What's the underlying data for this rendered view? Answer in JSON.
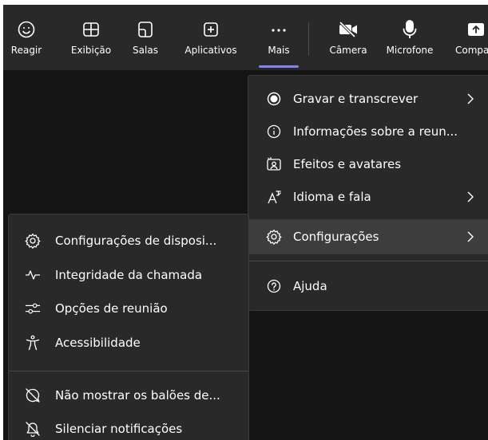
{
  "toolbar": {
    "buttons": [
      {
        "label": "Reagir",
        "icon": "emoji-icon"
      },
      {
        "label": "Exibição",
        "icon": "grid-view-icon"
      },
      {
        "label": "Salas",
        "icon": "breakout-rooms-icon"
      },
      {
        "label": "Aplicativos",
        "icon": "add-apps-icon"
      },
      {
        "label": "Mais",
        "icon": "more-icon"
      },
      {
        "label": "Câmera",
        "icon": "camera-off-icon"
      },
      {
        "label": "Microfone",
        "icon": "microphone-icon"
      },
      {
        "label": "Compart",
        "icon": "share-icon"
      }
    ],
    "active": "Mais"
  },
  "more_menu": {
    "items": [
      {
        "label": "Gravar e transcrever",
        "icon": "record-icon",
        "submenu": true
      },
      {
        "label": "Informações sobre a reun...",
        "icon": "info-icon",
        "submenu": false
      },
      {
        "label": "Efeitos e avatares",
        "icon": "effects-icon",
        "submenu": false
      },
      {
        "label": "Idioma e fala",
        "icon": "language-icon",
        "submenu": true
      },
      {
        "label": "Configurações",
        "icon": "gear-icon",
        "submenu": true,
        "selected": true
      },
      {
        "label": "Ajuda",
        "icon": "help-icon",
        "submenu": false
      }
    ]
  },
  "settings_submenu": {
    "items": [
      {
        "label": "Configurações de disposi...",
        "icon": "device-settings-icon"
      },
      {
        "label": "Integridade da chamada",
        "icon": "call-health-icon"
      },
      {
        "label": "Opções de reunião",
        "icon": "meeting-options-icon"
      },
      {
        "label": "Acessibilidade",
        "icon": "accessibility-icon"
      },
      {
        "label": "Não mostrar os balões de...",
        "icon": "chat-bubbles-off-icon"
      },
      {
        "label": "Silenciar notificações",
        "icon": "notifications-off-icon"
      }
    ]
  },
  "colors": {
    "background": "#141414",
    "panel": "#292929",
    "selected": "#3d3d3d",
    "accent": "#7f85f5",
    "text": "#ffffff"
  }
}
